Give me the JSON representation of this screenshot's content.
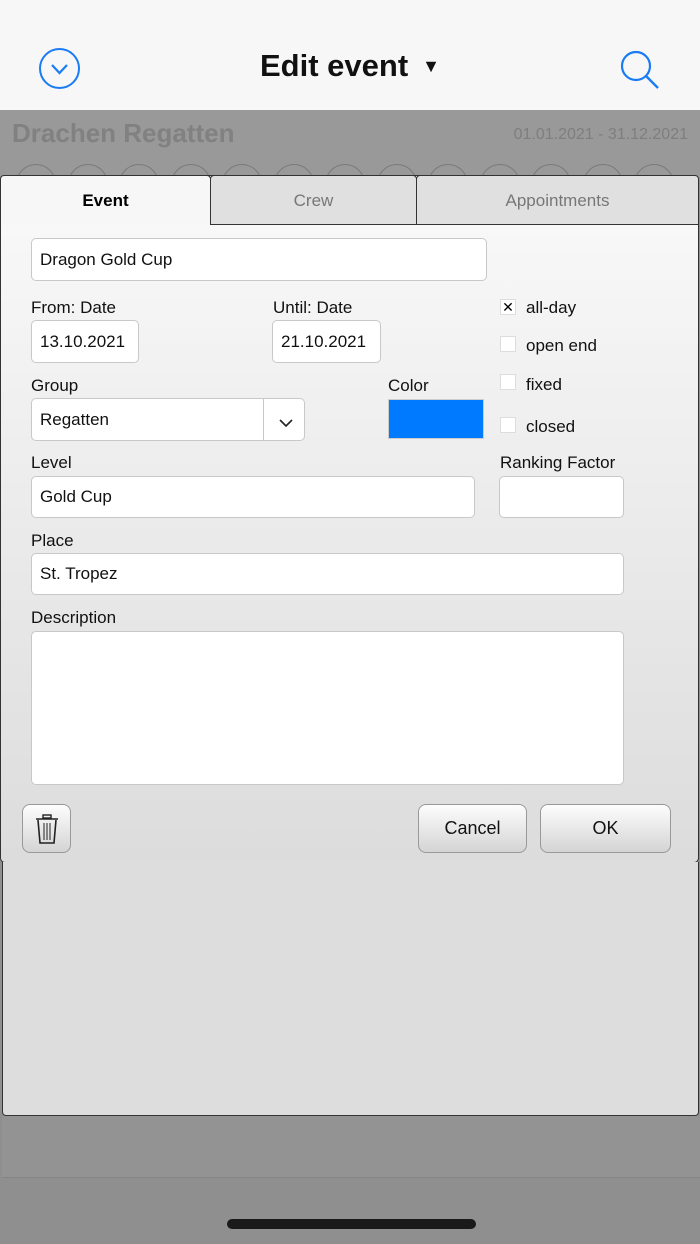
{
  "header": {
    "title": "Edit event",
    "back_icon": "chevron-down-circle-icon",
    "search_icon": "search-icon",
    "accent": "#1a7cf5"
  },
  "background": {
    "title": "Drachen Regatten",
    "date_range": "01.01.2021 - 31.12.2021"
  },
  "tabs": [
    {
      "label": "Event",
      "active": true
    },
    {
      "label": "Crew",
      "active": false
    },
    {
      "label": "Appointments",
      "active": false
    }
  ],
  "form": {
    "name_value": "Dragon Gold Cup",
    "from_label": "From: Date",
    "from_value": "13.10.2021",
    "until_label": "Until: Date",
    "until_value": "21.10.2021",
    "checkboxes": [
      {
        "label": "all-day",
        "checked": true
      },
      {
        "label": "open end",
        "checked": false
      },
      {
        "label": "fixed",
        "checked": false
      },
      {
        "label": "closed",
        "checked": false
      }
    ],
    "check_mark": "✕",
    "group_label": "Group",
    "group_value": "Regatten",
    "color_label": "Color",
    "color_value": "#007aff",
    "level_label": "Level",
    "level_value": "Gold Cup",
    "ranking_label": "Ranking Factor",
    "ranking_value": "",
    "place_label": "Place",
    "place_value": "St. Tropez",
    "description_label": "Description",
    "description_value": ""
  },
  "buttons": {
    "cancel": "Cancel",
    "ok": "OK",
    "delete_icon": "trash-icon"
  }
}
